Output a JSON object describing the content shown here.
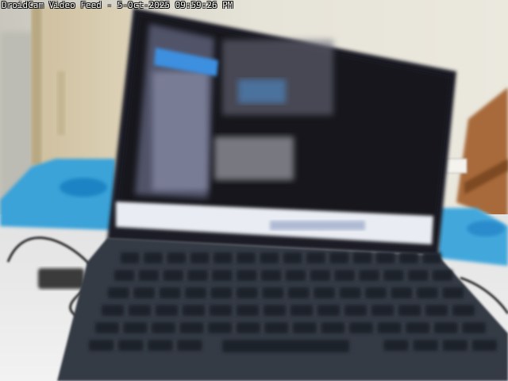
{
  "overlay": {
    "app_name": "DroidCam Video Feed",
    "separator": " - ",
    "date": "5-Oct-2025",
    "time": "09:59:26 PM"
  }
}
